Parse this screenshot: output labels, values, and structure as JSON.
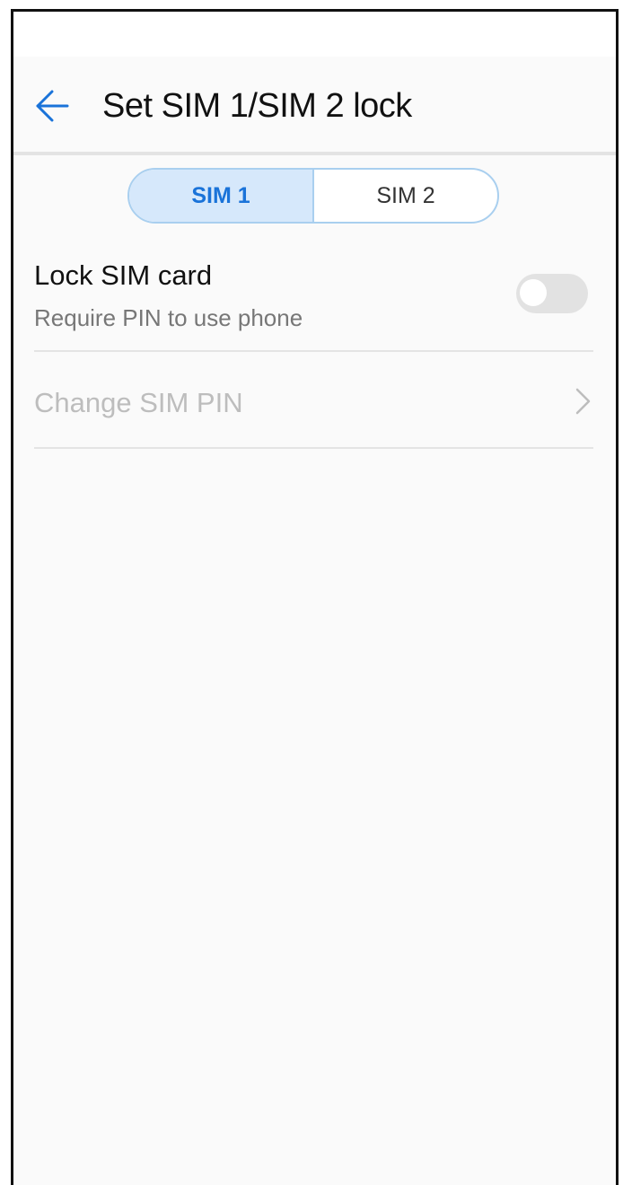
{
  "header": {
    "title": "Set SIM 1/SIM 2 lock",
    "back_icon": "arrow-left-icon"
  },
  "sim_tabs": {
    "items": [
      {
        "label": "SIM 1",
        "selected": true
      },
      {
        "label": "SIM 2",
        "selected": false
      }
    ]
  },
  "settings": {
    "lock_sim": {
      "title": "Lock SIM card",
      "subtitle": "Require PIN to use phone",
      "enabled": false
    },
    "change_pin": {
      "label": "Change SIM PIN",
      "enabled": false,
      "icon": "chevron-right-icon"
    }
  },
  "colors": {
    "accent": "#1a73d9",
    "tab_selected_bg": "#d6e8fb",
    "tab_border": "#a9cfef",
    "toggle_off": "#e2e2e2",
    "disabled_text": "#bdbdbd"
  }
}
